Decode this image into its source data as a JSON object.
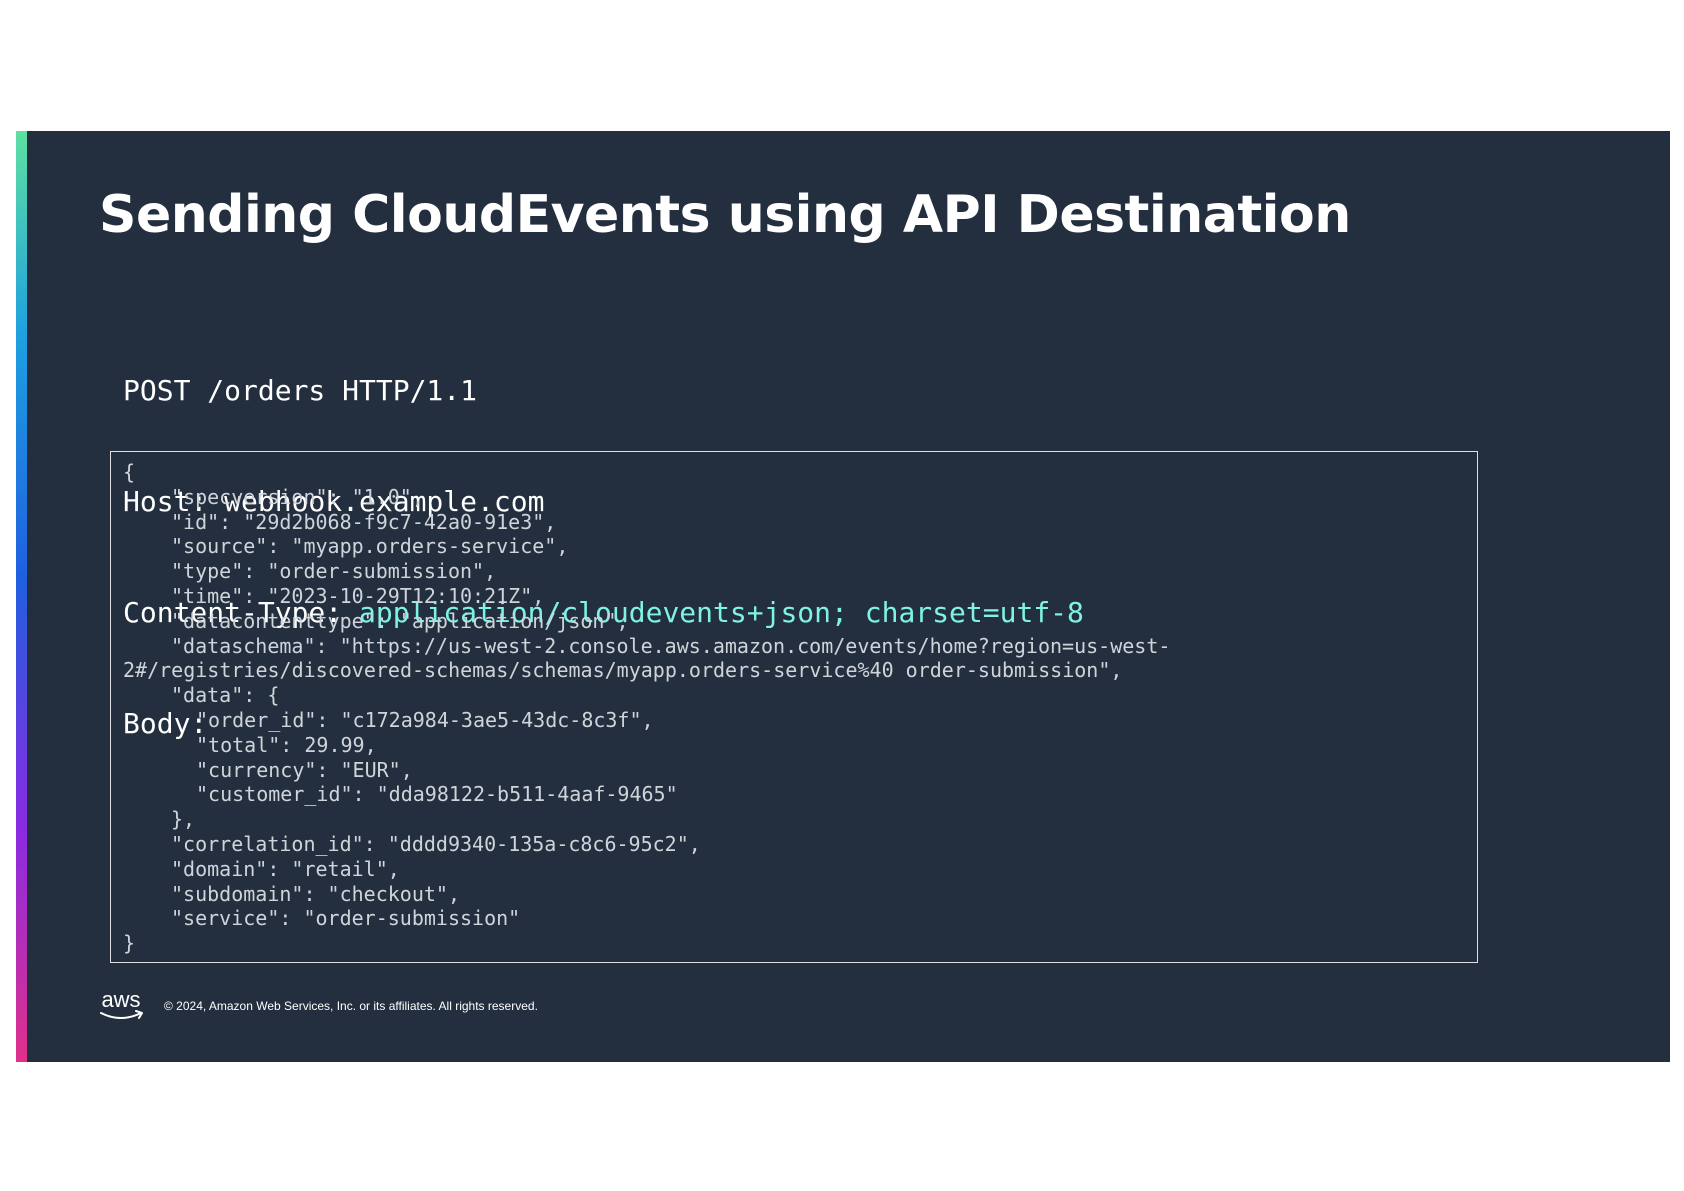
{
  "slide": {
    "title": "Sending CloudEvents using API Destination",
    "request": {
      "line1": "POST /orders HTTP/1.1",
      "host_line": "Host: webhook.example.com",
      "content_type_key": "Content-Type: ",
      "content_type_value": "application/cloudevents+json; charset=utf-8",
      "body_label": "Body:"
    },
    "body_lines": [
      "{",
      "\"specversion\": \"1.0\",",
      "\"id\": \"29d2b068-f9c7-42a0-91e3\",",
      "\"source\": \"myapp.orders-service\",",
      "\"type\": \"order-submission\",",
      "\"time\": \"2023-10-29T12:10:21Z\",",
      "\"datacontenttype\": \"application/json\",",
      "\"dataschema\": \"https://us-west-2.console.aws.amazon.com/events/home?region=us-west-",
      "2#/registries/discovered-schemas/schemas/myapp.orders-service%40 order-submission\",",
      "\"data\": {",
      "\"order_id\": \"c172a984-3ae5-43dc-8c3f\",",
      "\"total\": 29.99,",
      "\"currency\": \"EUR\",",
      "\"customer_id\": \"dda98122-b511-4aaf-9465\"",
      "},",
      "\"correlation_id\": \"dddd9340-135a-c8c6-95c2\",",
      "\"domain\": \"retail\",",
      "\"subdomain\": \"checkout\",",
      "\"service\": \"order-submission\"",
      "}"
    ],
    "footer": {
      "logo_text": "aws",
      "copyright": "© 2024, Amazon Web Services, Inc. or its affiliates. All rights reserved."
    },
    "colors": {
      "background": "#232f3e",
      "highlight": "#7ef2e4",
      "accent_gradient": [
        "#5ee0a0",
        "#1ea0e0",
        "#1f5fe0",
        "#8a2be2",
        "#e0308a"
      ]
    }
  }
}
